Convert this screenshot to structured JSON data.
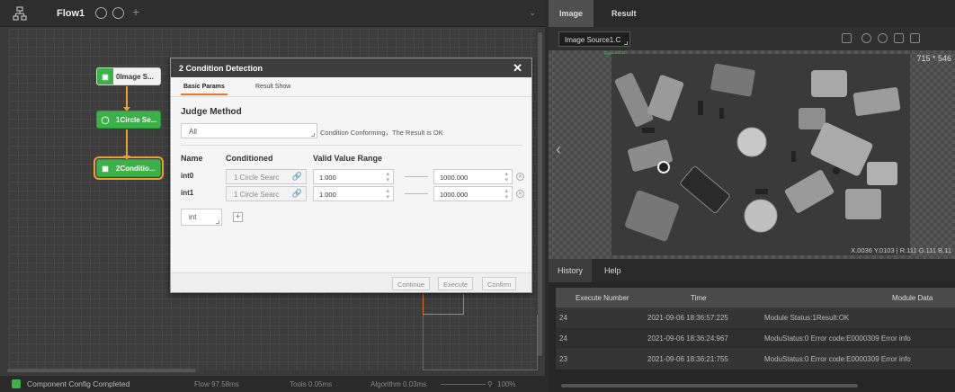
{
  "flow": {
    "title": "Flow1",
    "nodes": [
      {
        "label": "0Image S..."
      },
      {
        "label": "1Circle Se..."
      },
      {
        "label": "2Conditio..."
      }
    ]
  },
  "status": {
    "message": "Component Config Completed",
    "flow_time": "Flow 97.58ms",
    "tools_time": "Tools 0.05ms",
    "algorithm_time": "Algorithm 0.03ms",
    "zoom": "100%"
  },
  "dialog": {
    "title": "2 Condition Detection",
    "tabs": [
      "Basic Params",
      "Result Show"
    ],
    "judge_method_label": "Judge Method",
    "judge_method_value": "All",
    "judge_hint": "Condition Conforming，The Result is OK",
    "columns": {
      "name": "Name",
      "conditioned": "Conditioned",
      "range": "Valid Value Range"
    },
    "rows": [
      {
        "name": "int0",
        "conditioned": "1 Circle Searc",
        "min": "1.000",
        "max": "1000.000"
      },
      {
        "name": "int1",
        "conditioned": "1 Circle Searc",
        "min": "1.000",
        "max": "1000.000"
      }
    ],
    "type_select": "int",
    "buttons": {
      "continue": "Continue",
      "execute": "Execute",
      "confirm": "Confirm"
    }
  },
  "right": {
    "tabs": [
      "Image",
      "Result"
    ],
    "image_source": "Image Source1.C",
    "resolution": "715 * 546",
    "ok_mark": "Result:OK",
    "coords": "X.0036  Y.0103  |  R.111  G.111  B.11",
    "bottom_tabs": [
      "History",
      "Help"
    ],
    "table": {
      "headers": [
        "Execute Number",
        "Time",
        "Module Data"
      ],
      "rows": [
        {
          "number": "24",
          "time": "2021-09-06 18:36:57:225",
          "data": "Module Status:1Result:OK"
        },
        {
          "number": "24",
          "time": "2021-09-06 18:36:24:967",
          "data": "ModuStatus:0 Error code:E0000309 Error info"
        },
        {
          "number": "23",
          "time": "2021-09-06 18:36:21:755",
          "data": "ModuStatus:0 Error code:E0000309 Error info"
        }
      ]
    }
  }
}
